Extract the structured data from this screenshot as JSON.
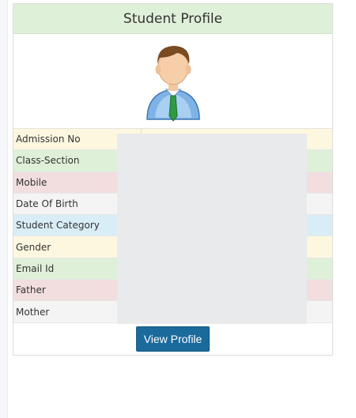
{
  "header": {
    "title": "Student Profile"
  },
  "profile": {
    "avatar_icon": "user-avatar-icon",
    "fields": [
      {
        "label": "Admission No",
        "value": ""
      },
      {
        "label": "Class-Section",
        "value": ""
      },
      {
        "label": "Mobile",
        "value": ""
      },
      {
        "label": "Date Of Birth",
        "value": ""
      },
      {
        "label": "Student Category",
        "value": ""
      },
      {
        "label": "Gender",
        "value": ""
      },
      {
        "label": "Email Id",
        "value": ""
      },
      {
        "label": "Father",
        "value": ""
      },
      {
        "label": "Mother",
        "value": ""
      }
    ]
  },
  "actions": {
    "view_profile_label": "View Profile"
  },
  "colors": {
    "header_bg": "#dff0d8",
    "button_bg": "#1b6a9c",
    "row_yellow": "#fdf7df",
    "row_green": "#dff0d8",
    "row_red": "#f2dede",
    "row_grey": "#f4f4f4",
    "row_blue": "#d9edf7"
  }
}
